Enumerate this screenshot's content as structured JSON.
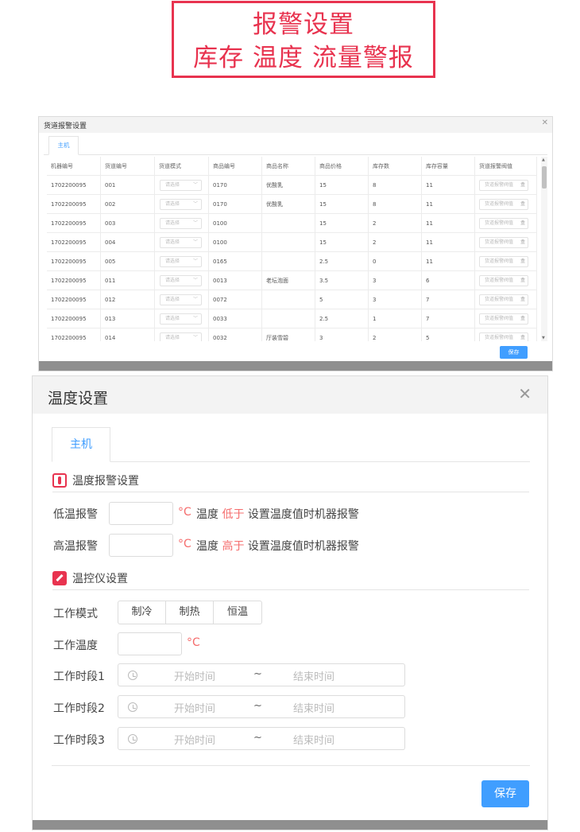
{
  "banner": {
    "line1": "报警设置",
    "line2": "库存 温度 流量警报",
    "color": "#e8334f"
  },
  "stock_dialog": {
    "title": "货道报警设置",
    "close_icon": "close-icon",
    "tab": "主机",
    "columns": [
      "机器编号",
      "货道编号",
      "货道模式",
      "商品编号",
      "商品名称",
      "商品价格",
      "库存数",
      "库存容量",
      "货道报警阀值"
    ],
    "select_placeholder": "请选择",
    "threshold_placeholder": "货道报警阀值",
    "threshold_unit": "盒",
    "rows": [
      {
        "machine": "1702200095",
        "lane": "001",
        "product_no": "0170",
        "product_name": "优酸乳",
        "price": "15",
        "stock": "8",
        "capacity": "11"
      },
      {
        "machine": "1702200095",
        "lane": "002",
        "product_no": "0170",
        "product_name": "优酸乳",
        "price": "15",
        "stock": "8",
        "capacity": "11"
      },
      {
        "machine": "1702200095",
        "lane": "003",
        "product_no": "0100",
        "product_name": "",
        "price": "15",
        "stock": "2",
        "capacity": "11"
      },
      {
        "machine": "1702200095",
        "lane": "004",
        "product_no": "0100",
        "product_name": "",
        "price": "15",
        "stock": "2",
        "capacity": "11"
      },
      {
        "machine": "1702200095",
        "lane": "005",
        "product_no": "0165",
        "product_name": "",
        "price": "2.5",
        "stock": "0",
        "capacity": "11"
      },
      {
        "machine": "1702200095",
        "lane": "011",
        "product_no": "0013",
        "product_name": "老坛泡面",
        "price": "3.5",
        "stock": "3",
        "capacity": "6"
      },
      {
        "machine": "1702200095",
        "lane": "012",
        "product_no": "0072",
        "product_name": "",
        "price": "5",
        "stock": "3",
        "capacity": "7"
      },
      {
        "machine": "1702200095",
        "lane": "013",
        "product_no": "0033",
        "product_name": "",
        "price": "2.5",
        "stock": "1",
        "capacity": "7"
      },
      {
        "machine": "1702200095",
        "lane": "014",
        "product_no": "0032",
        "product_name": "厅装雪碧",
        "price": "3",
        "stock": "2",
        "capacity": "5"
      }
    ],
    "save_label": "保存"
  },
  "temp_dialog": {
    "title": "温度设置",
    "close_icon": "close-icon",
    "tab": "主机",
    "alarm_section": "温度报警设置",
    "alarm_icon": "thermometer-icon",
    "low_label": "低温报警",
    "high_label": "高温报警",
    "unit": "°C",
    "temp_word": "温度",
    "low_word": "低于",
    "high_word": "高于",
    "alarm_suffix": "设置温度值时机器报警",
    "control_section": "温控仪设置",
    "control_icon": "edit-icon",
    "mode_label": "工作模式",
    "modes": [
      "制冷",
      "制热",
      "恒温"
    ],
    "work_temp_label": "工作温度",
    "period_labels": [
      "工作时段1",
      "工作时段2",
      "工作时段3"
    ],
    "start_placeholder": "开始时间",
    "range_sep": "~",
    "end_placeholder": "结束时间",
    "clock_icon": "clock-icon",
    "save_label": "保存"
  },
  "colors": {
    "accent": "#409eff",
    "alert": "#f56c6c",
    "brand_red": "#e8334f"
  }
}
